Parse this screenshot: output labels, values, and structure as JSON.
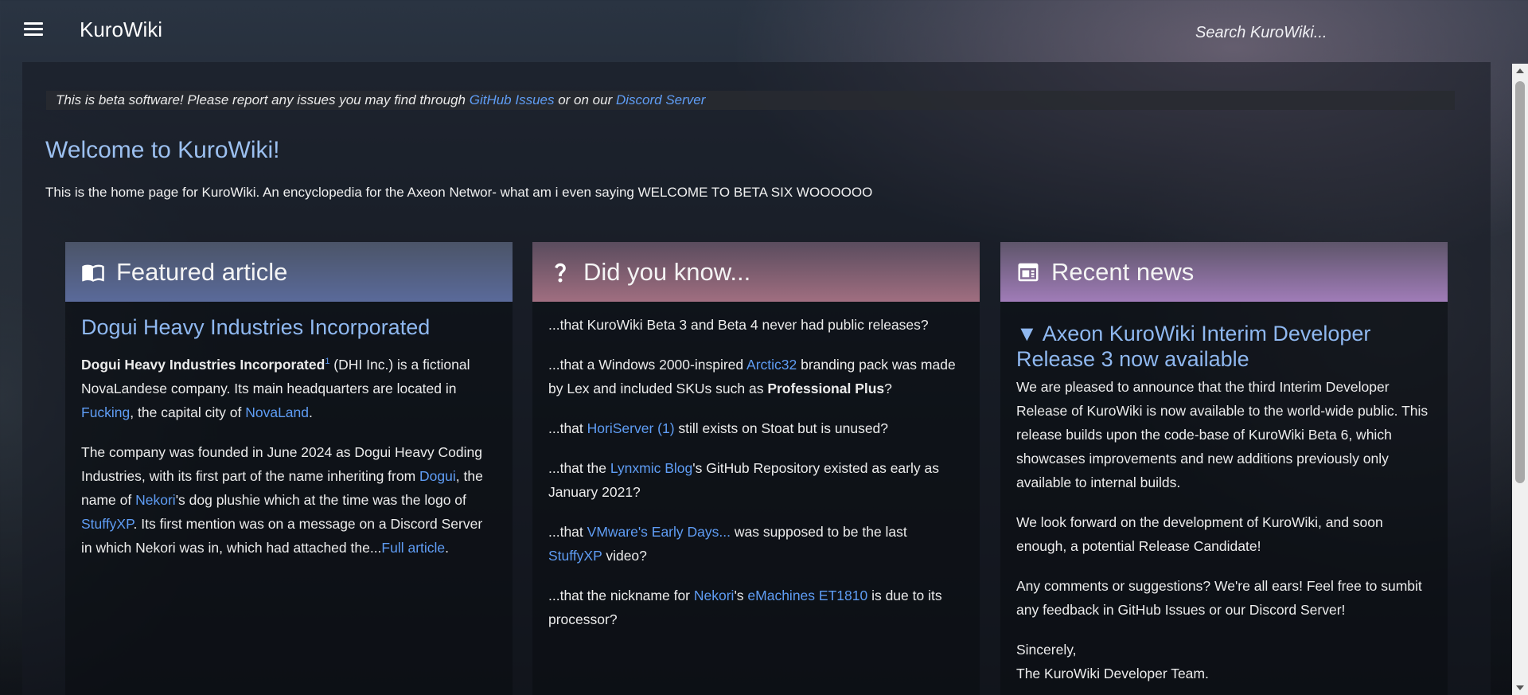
{
  "header": {
    "menu_icon": "hamburger-menu-icon",
    "brand": "KuroWiki",
    "search_placeholder": "Search KuroWiki..."
  },
  "beta_notice": {
    "text_before": "This is beta software! Please report any issues you may find through ",
    "link1": "GitHub Issues",
    "text_mid": " or on our ",
    "link2": "Discord Server"
  },
  "welcome": {
    "title": "Welcome to KuroWiki!",
    "intro": "This is the home page for KuroWiki. An encyclopedia for the Axeon Networ- what am i even saying WELCOME TO BETA SIX WOOOOOO"
  },
  "featured": {
    "icon": "book-icon",
    "heading": "Featured article",
    "title": "Dogui Heavy Industries Incorporated",
    "p1_bold": "Dogui Heavy Industries Incorporated",
    "p1_sup": "1",
    "p1_a": " (DHI Inc.) is a fictional NovaLandese company. Its main headquarters are located in ",
    "p1_link1": "Fucking",
    "p1_b": ", the capital city of ",
    "p1_link2": "NovaLand",
    "p1_c": ".",
    "p2_a": "The company was founded in June 2024 as Dogui Heavy Coding Industries, with its first part of the name inheriting from ",
    "p2_link1": "Dogui",
    "p2_b": ", the name of ",
    "p2_link2": "Nekori",
    "p2_c": "'s dog plushie which at the time was the logo of ",
    "p2_link3": "StuffyXP",
    "p2_d": ". Its first mention was on a message on a Discord Server in which Nekori was in, which had attached the...",
    "p2_link4": "Full article",
    "p2_e": "."
  },
  "dyk": {
    "icon": "question-mark-icon",
    "heading": "Did you know...",
    "f1": "...that KuroWiki Beta 3 and Beta 4 never had public releases?",
    "f2_a": "...that a Windows 2000-inspired ",
    "f2_link": "Arctic32",
    "f2_b": " branding pack was made by Lex and included SKUs such as ",
    "f2_bold": "Professional Plus",
    "f2_c": "?",
    "f3_a": "...that ",
    "f3_link": "HoriServer (1)",
    "f3_b": " still exists on Stoat but is unused?",
    "f4_a": "...that the ",
    "f4_link": "Lynxmic Blog",
    "f4_b": "'s GitHub Repository existed as early as January 2021?",
    "f5_a": "...that ",
    "f5_link1": "VMware's Early Days...",
    "f5_b": " was supposed to be the last ",
    "f5_link2": "StuffyXP",
    "f5_c": " video?",
    "f6_a": "...that the nickname for ",
    "f6_link1": "Nekori",
    "f6_b": "'s ",
    "f6_link2": "eMachines ET1810",
    "f6_c": " is due to its processor?"
  },
  "news": {
    "icon": "newspaper-icon",
    "heading": "Recent news",
    "title": "▼ Axeon KuroWiki Interim Developer Release 3 now available",
    "p1": "We are pleased to announce that the third Interim Developer Release of KuroWiki is now available to the world-wide public. This release builds upon the code-base of KuroWiki Beta 6, which showcases improvements and new additions previously only available to internal builds.",
    "p2": "We look forward on the development of KuroWiki, and soon enough, a potential Release Candidate!",
    "p3": "Any comments or suggestions? We're all ears! Feel free to sumbit any feedback in GitHub Issues or our Discord Server!",
    "sign1": "Sincerely,",
    "sign2": "The KuroWiki Developer Team."
  },
  "colors": {
    "link": "#5f9df5",
    "heading": "#9cc0f0"
  }
}
